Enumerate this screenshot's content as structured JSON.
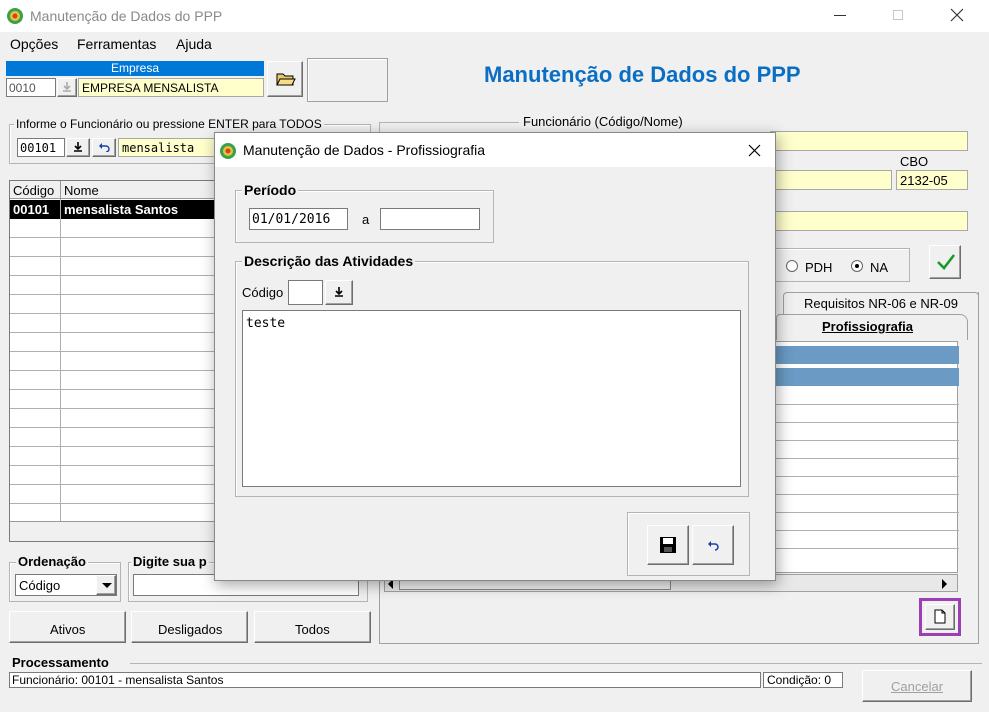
{
  "window": {
    "title": "Manutenção de Dados do PPP",
    "min_icon": "minimize-icon",
    "max_icon": "maximize-icon",
    "close_icon": "close-icon"
  },
  "menu": [
    "Opções",
    "Ferramentas",
    "Ajuda"
  ],
  "empresa": {
    "label": "Empresa",
    "code": "0010",
    "name": "EMPRESA MENSALISTA"
  },
  "page_title": "Manutenção de Dados do PPP",
  "search": {
    "label": "Informe o Funcionário ou pressione ENTER para TODOS",
    "code": "00101",
    "name": "mensalista"
  },
  "funcionario": {
    "label": "Funcionário (Código/Nome)",
    "cbo_label": "CBO",
    "cbo_value": "2132-05"
  },
  "list": {
    "col_code": "Código",
    "col_name": "Nome",
    "rows": [
      {
        "code": "00101",
        "name": "mensalista Santos"
      }
    ]
  },
  "ordenacao": {
    "label": "Ordenação",
    "value": "Código",
    "search_label": "Digite sua p"
  },
  "status_buttons": [
    "Ativos",
    "Desligados",
    "Todos"
  ],
  "radios": {
    "pdh": "PDH",
    "na": "NA",
    "selected": "NA"
  },
  "tabs": {
    "tab1": "Requisitos NR-06 e NR-09",
    "tab2": "Profissiografia"
  },
  "processamento": {
    "label": "Processamento",
    "text": "Funcionário: 00101 - mensalista Santos",
    "condicao": "Condição: 0",
    "cancel": "Cancelar"
  },
  "dialog": {
    "title": "Manutenção de Dados - Profissiografia",
    "periodo_label": "Período",
    "date_from": "01/01/2016",
    "date_sep": "a",
    "date_to": "",
    "desc_label": "Descrição das Atividades",
    "codigo_label": "Código",
    "codigo_value": "",
    "text": "teste"
  },
  "colors": {
    "title_blue": "#0a6fc4",
    "empresa_header": "#0078d7",
    "selected_row": "#000000",
    "grid_header_blue": "#6b9ac4",
    "highlight_border": "#9b3fb5"
  }
}
